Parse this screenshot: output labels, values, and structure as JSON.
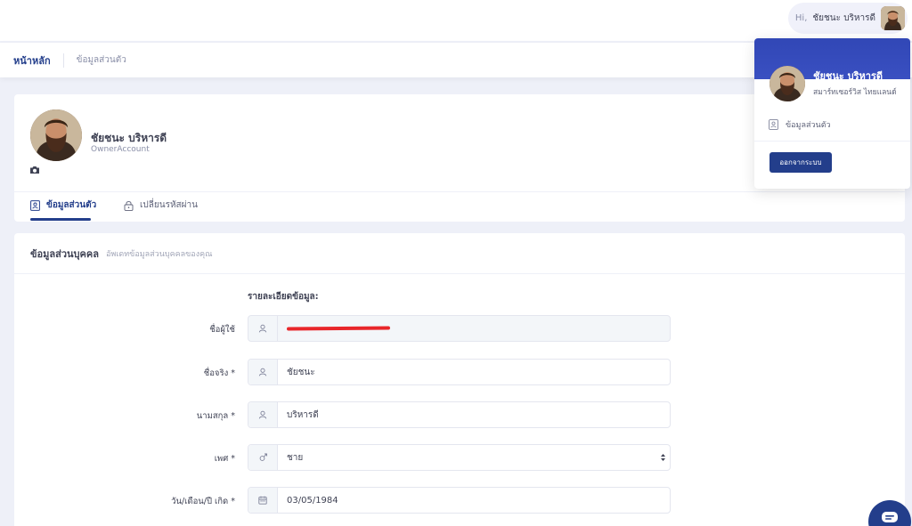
{
  "header": {
    "greeting": "Hi,",
    "user_name": "ชัยชนะ บริหารดี"
  },
  "subheader": {
    "title": "หน้าหลัก",
    "breadcrumb": "ข้อมูลส่วนตัว"
  },
  "profile": {
    "name": "ชัยชนะ บริหารดี",
    "account_type": "OwnerAccount",
    "tabs": [
      {
        "label": "ข้อมูลส่วนตัว",
        "icon": "id-card-icon",
        "active": true
      },
      {
        "label": "เปลี่ยนรหัสผ่าน",
        "icon": "lock-icon",
        "active": false
      }
    ]
  },
  "personal_info": {
    "title": "ข้อมูลส่วนบุคคล",
    "description": "อัพเดทข้อมูลส่วนบุคคลของคุณ",
    "section_label": "รายละเอียดข้อมูล:",
    "fields": {
      "username": {
        "label": "ชื่อผู้ใช้",
        "value": "",
        "icon": "user-icon"
      },
      "first_name": {
        "label": "ชื่อจริง *",
        "value": "ชัยชนะ",
        "icon": "user-icon"
      },
      "last_name": {
        "label": "นามสกุล *",
        "value": "บริหารดี",
        "icon": "user-icon"
      },
      "gender": {
        "label": "เพศ *",
        "value": "ชาย",
        "icon": "gender-icon"
      },
      "birthdate": {
        "label": "วัน/เดือน/ปี เกิด *",
        "value": "03/05/1984",
        "icon": "calendar-icon"
      }
    }
  },
  "user_dropdown": {
    "name": "ชัยชนะ บริหารดี",
    "company": "สมาร์ทเซอร์วิส ไทยแลนด์",
    "menu_item": "ข้อมูลส่วนตัว",
    "logout_label": "ออกจากระบบ"
  },
  "colors": {
    "primary": "#233e8b",
    "dropdown_header": "#3f55c8",
    "background": "#eef0f8",
    "redaction": "#e8262a"
  }
}
